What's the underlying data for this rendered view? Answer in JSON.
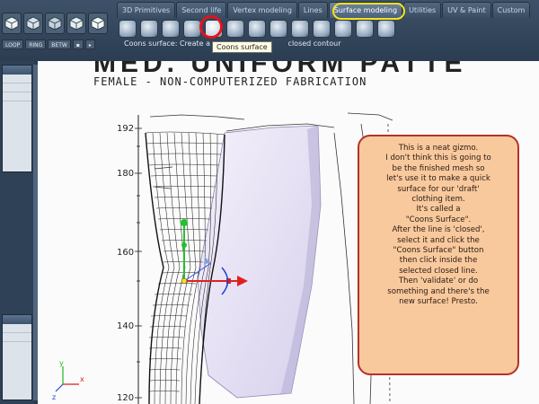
{
  "toolbar": {
    "tabs": [
      {
        "label": "3D Primitives"
      },
      {
        "label": "Second life"
      },
      {
        "label": "Vertex modeling"
      },
      {
        "label": "Lines"
      },
      {
        "label": "Surface modeling"
      },
      {
        "label": "Utilities"
      },
      {
        "label": "UV & Paint"
      },
      {
        "label": "Custom"
      }
    ],
    "active_tab": "Surface modeling",
    "mini_buttons": [
      "LOOP",
      "RING",
      "BETW"
    ],
    "status_text": "Coons surface: Create a",
    "status_text_tail": "closed contour",
    "tooltip": "Coons surface",
    "tab_highlight_color": "#f3e31a",
    "tool_highlight_color": "#e2141c"
  },
  "drawing": {
    "title_line1": "MED. UNIFORM PATTE",
    "title_line2": "FEMALE - NON-COMPUTERIZED FABRICATION",
    "y_ticks": [
      "192",
      "180",
      "160",
      "140",
      "120"
    ]
  },
  "axes_gizmo": {
    "x": "x",
    "y": "y",
    "z": "z"
  },
  "callout": {
    "lines": [
      "This is a neat gizmo.",
      "I don't think this is going to",
      "be the finished mesh so",
      "let's use it to make a quick",
      "surface for our 'draft'",
      "clothing item.",
      "It's called a",
      "\"Coons Surface\".",
      "After the line is 'closed',",
      "select it and click the",
      "\"Coons Surface\" button",
      "then click inside the",
      "selected closed line.",
      "Then 'validate' or do",
      "something and there's the",
      "new surface! Presto."
    ],
    "background": "#f9c99e",
    "border": "#b4312b"
  }
}
